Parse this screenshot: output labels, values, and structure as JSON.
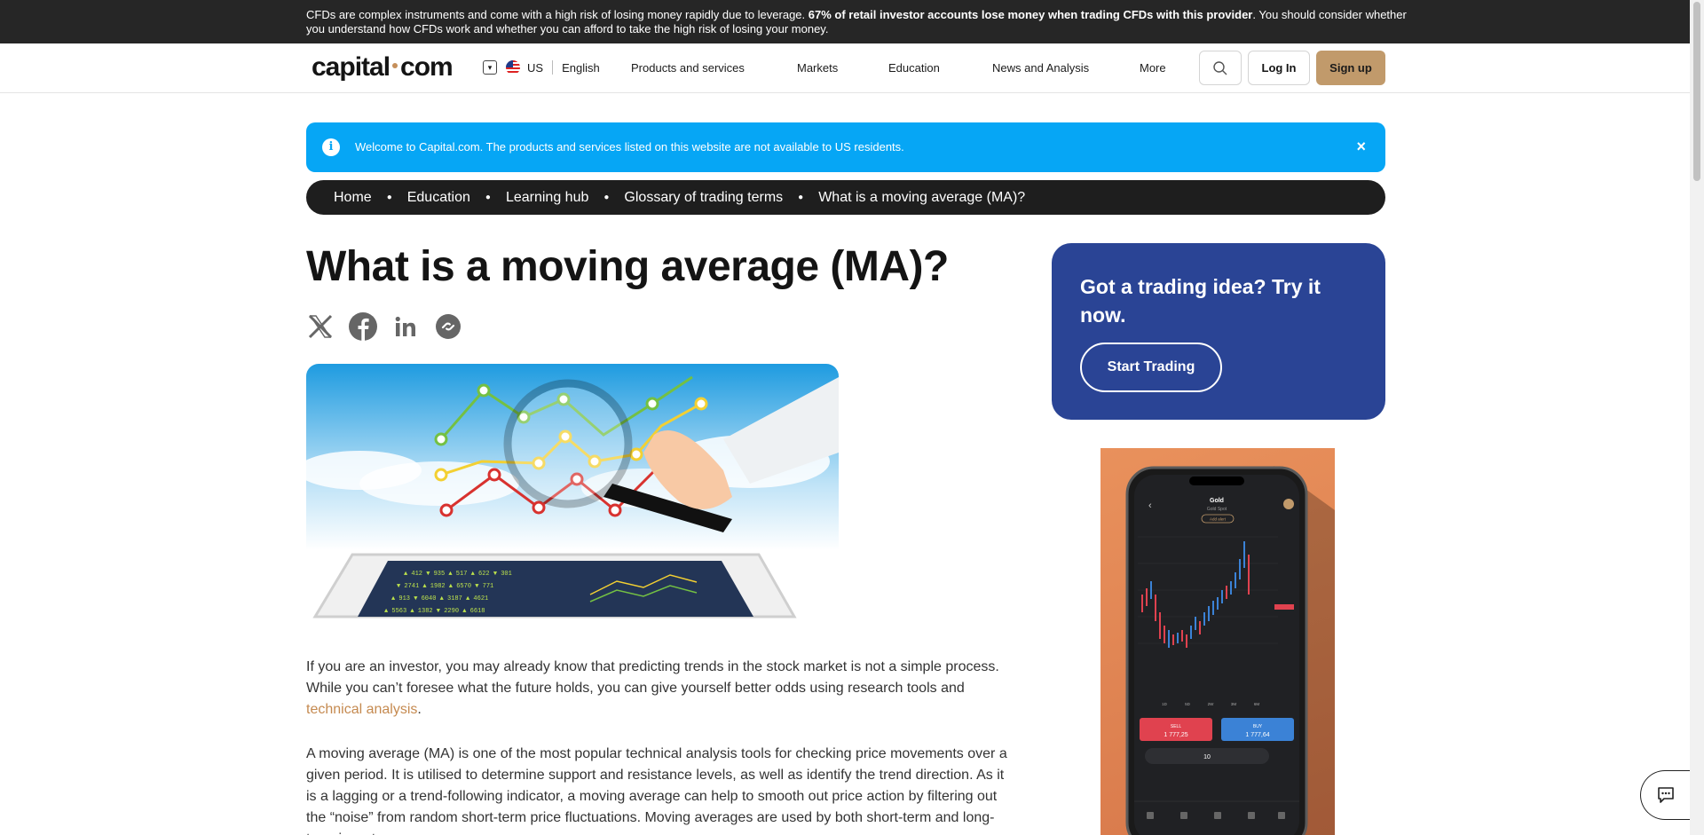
{
  "risk_warning": {
    "text_start": "CFDs are complex instruments and come with a high risk of losing money rapidly due to leverage. ",
    "text_bold": "67% of retail investor accounts lose money when trading CFDs with this provider",
    "text_end": ". You should consider whether you understand how CFDs work and whether you can afford to take the high risk of losing your money."
  },
  "header": {
    "logo_left": "capital",
    "logo_right": "com",
    "region": "US",
    "language": "English",
    "nav": [
      "Products and services",
      "Markets",
      "Education",
      "News and Analysis",
      "More"
    ],
    "login_label": "Log In",
    "signup_label": "Sign up"
  },
  "banner": {
    "icon": "i",
    "text": "Welcome to Capital.com. The products and services listed on this website are not available to US residents.",
    "close": "×"
  },
  "breadcrumb": [
    "Home",
    "Education",
    "Learning hub",
    "Glossary of trading terms",
    "What is a moving average (MA)?"
  ],
  "article": {
    "title": "What is a moving average (MA)?",
    "p1_a": "If you are an investor, you may already know that predicting trends in the stock market is not a simple process. While you can’t foresee what the future holds, you can give yourself better odds using research tools and ",
    "p1_link": "technical analysis",
    "p1_b": ".",
    "p2": "A moving average (MA) is one of the most popular technical analysis tools for checking price movements over a given period. It is utilised to determine support and resistance levels, as well as identify the trend direction. As it is a lagging or a trend-following indicator, a moving average can help to smooth out price action by filtering out the “noise” from random short-term price fluctuations. Moving averages are used by both short-term and long-term investors."
  },
  "sidebar": {
    "cta_title": "Got a trading idea? Try it now.",
    "cta_button": "Start Trading",
    "phone": {
      "asset": "Gold",
      "sub": "Gold Spot",
      "alert": "Add alert",
      "periods": [
        "1D",
        "5D",
        "2W",
        "3M",
        "6M"
      ],
      "sell_label": "SELL",
      "sell_price": "1 777,25",
      "buy_label": "BUY",
      "buy_price": "1 777,64",
      "amount": "10"
    }
  },
  "colors": {
    "accent": "#c19a6b",
    "banner": "#06a6f5",
    "cta": "#2a4495",
    "sell": "#e0424f",
    "buy": "#3b82d6"
  }
}
